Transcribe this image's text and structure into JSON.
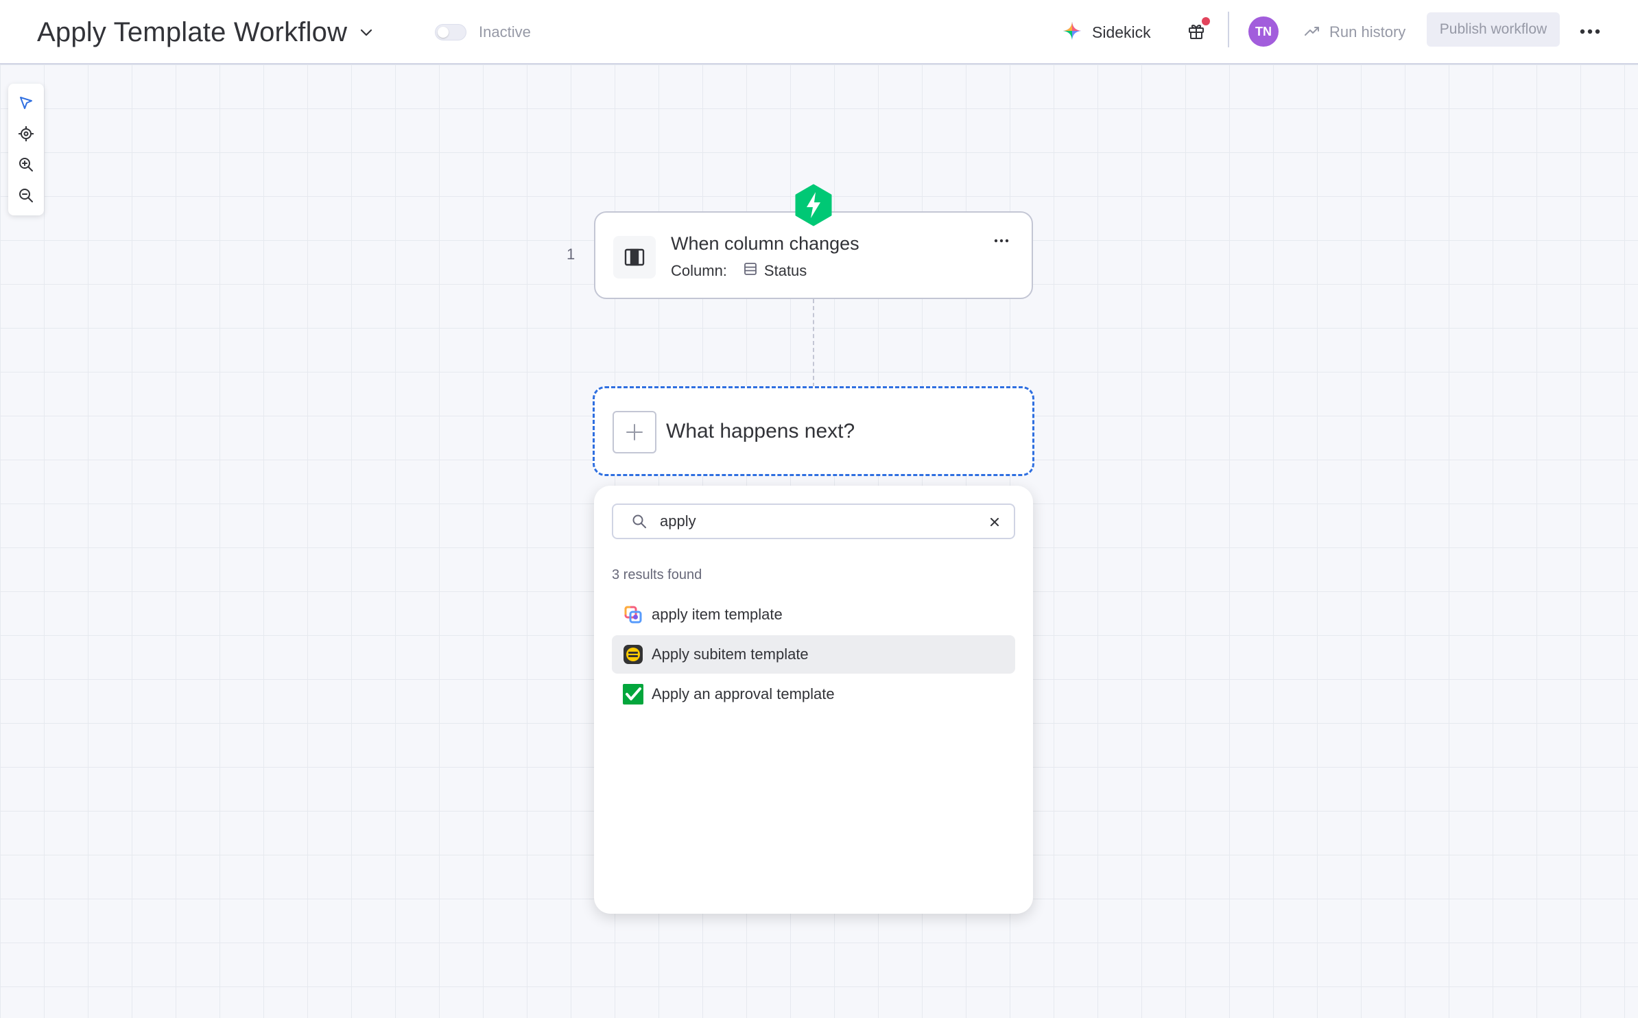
{
  "header": {
    "workflow_title": "Apply Template Workflow",
    "status_label": "Inactive",
    "sidekick_label": "Sidekick",
    "avatar_initials": "TN",
    "run_history_label": "Run history",
    "publish_label": "Publish workflow"
  },
  "toolbar": {
    "tools": [
      {
        "name": "select-cursor-icon",
        "active": true
      },
      {
        "name": "recenter-icon",
        "active": false
      },
      {
        "name": "zoom-in-icon",
        "active": false
      },
      {
        "name": "zoom-out-icon",
        "active": false
      }
    ]
  },
  "trigger": {
    "step_number": "1",
    "title": "When column changes",
    "column_label": "Column:",
    "column_value": "Status"
  },
  "next_step": {
    "title": "What happens next?"
  },
  "search_panel": {
    "query": "apply",
    "results_count": "3 results found",
    "results": [
      {
        "label": "apply item template",
        "icon": "item-template-icon"
      },
      {
        "label": "Apply subitem template",
        "icon": "subitem-template-icon"
      },
      {
        "label": "Apply an approval template",
        "icon": "approval-check-icon"
      }
    ]
  },
  "colors": {
    "accent": "#2f6fe0",
    "trigger_green": "#00c875",
    "avatar": "#a25ddc",
    "notification": "#e2445c"
  }
}
